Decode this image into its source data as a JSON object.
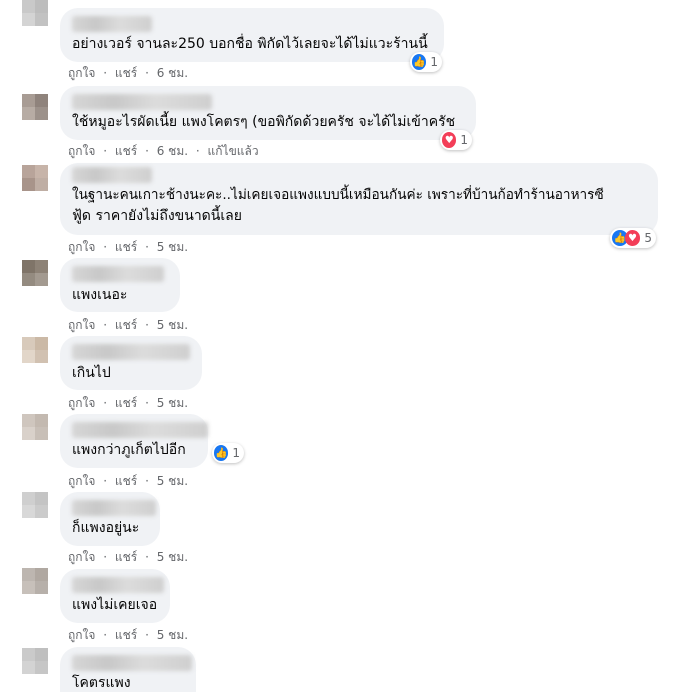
{
  "labels": {
    "like": "ถูกใจ",
    "dot": "·",
    "share": "แชร์",
    "edited": "แก้ไขแล้ว"
  },
  "comments": [
    {
      "text": "อย่างเวอร์ จานละ250 บอกชื่อ พิกัดไว้เลยจะได้ไม่แวะร้านนี้",
      "time": "6 ชม.",
      "reactions": [
        "like"
      ],
      "count": "1"
    },
    {
      "text": "ใช้หมูอะไรผัดเนี้ย แพงโคตรๆ (ขอพิกัดด้วยครัช จะได้ไม่เข้าครัช",
      "time": "6 ชม.",
      "edited": true,
      "reactions": [
        "love"
      ],
      "count": "1"
    },
    {
      "text_lines": [
        "ในฐานะคนเกาะช้างนะคะ..ไม่เคยเจอแพงแบบนี้เหมือนกันค่ะ เพราะที่บ้านก้อทำร้านอาหารซี",
        "ฟู้ด ราคายังไม่ถึงขนาดนี้เลย"
      ],
      "time": "5 ชม.",
      "reactions": [
        "like",
        "love"
      ],
      "count": "5"
    },
    {
      "text": "แพงเนอะ",
      "time": "5 ชม."
    },
    {
      "text": "เกินไป",
      "time": "5 ชม."
    },
    {
      "text": "แพงกว่าภูเก็ตไปอีก",
      "time": "5 ชม.",
      "reactions": [
        "like"
      ],
      "count": "1"
    },
    {
      "text": "ก็แพงอยู่นะ",
      "time": "5 ชม."
    },
    {
      "text": "แพงไม่เคยเจอ",
      "time": "5 ชม."
    },
    {
      "text": "โคตรแพง"
    }
  ],
  "colors": {
    "bubble": "#f0f2f5",
    "meta": "#65676b",
    "like": "#1877f2",
    "love": "#f33e58"
  },
  "icons": {
    "like": "thumbs-up-icon",
    "love": "heart-icon"
  }
}
